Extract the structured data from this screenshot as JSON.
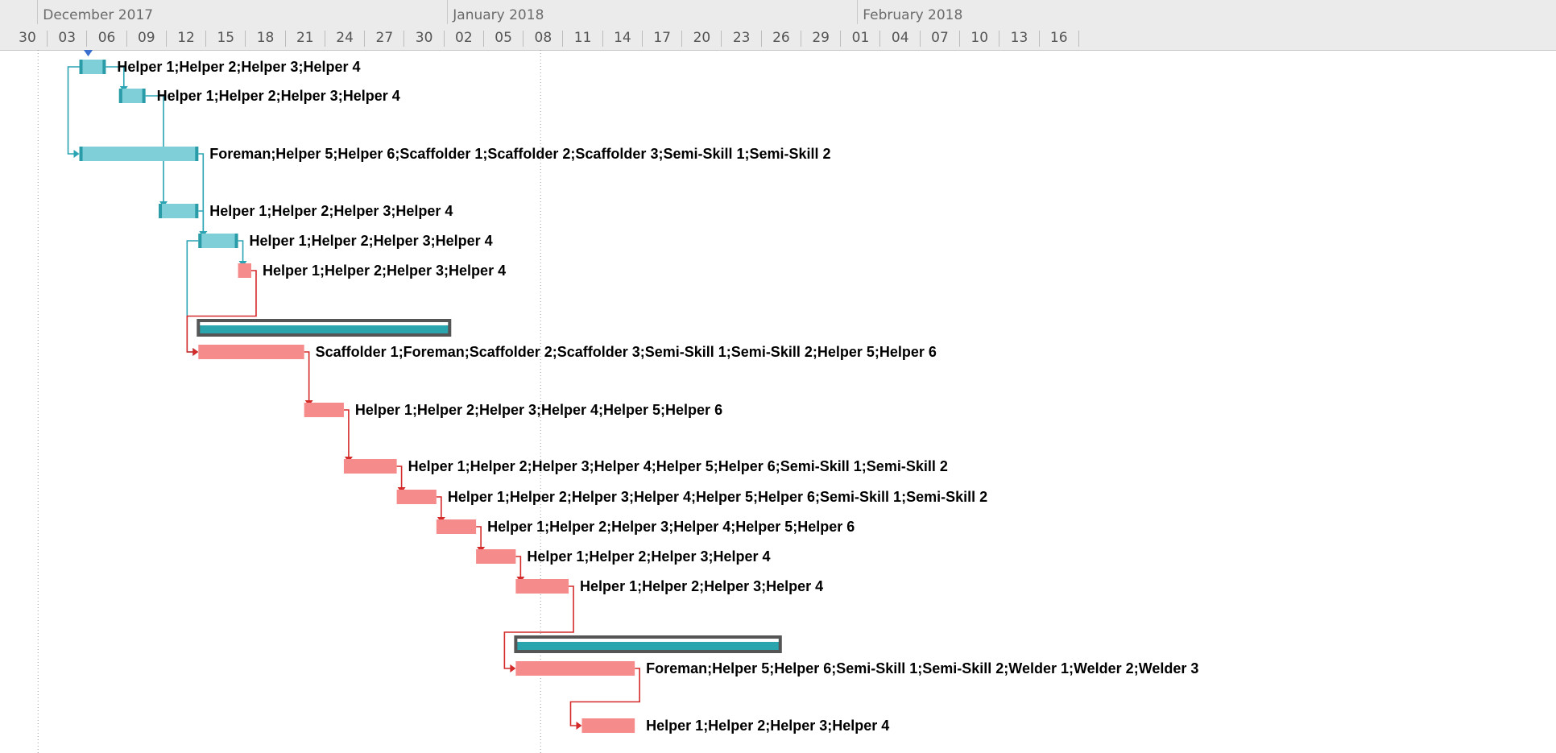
{
  "timescale": {
    "months": [
      "December 2017",
      "January 2018",
      "February 2018"
    ],
    "days": [
      "30",
      "03",
      "06",
      "09",
      "12",
      "15",
      "18",
      "21",
      "24",
      "27",
      "30",
      "02",
      "05",
      "08",
      "11",
      "14",
      "17",
      "20",
      "23",
      "26",
      "29",
      "01",
      "04",
      "07",
      "10",
      "13",
      "16"
    ]
  },
  "colors": {
    "normal_task": "#7ecfd8",
    "normal_link": "#2aa3b3",
    "critical_task": "#f58b8b",
    "critical_link": "#d42a2a",
    "summary_fill": "#2ba5ad",
    "summary_border": "#555555",
    "milestone": "#3a6fcf"
  },
  "chart_data": {
    "type": "gantt",
    "tasks": [
      {
        "start": "2017-12-04",
        "finish": "2017-12-06",
        "kind": "normal",
        "resources": "Helper 1;Helper 2;Helper 3;Helper 4"
      },
      {
        "start": "2017-12-07",
        "finish": "2017-12-09",
        "kind": "normal",
        "resources": "Helper 1;Helper 2;Helper 3;Helper 4"
      },
      {
        "start": "2017-12-04",
        "finish": "2017-12-13",
        "kind": "normal",
        "resources": "Foreman;Helper 5;Helper 6;Scaffolder 1;Scaffolder 2;Scaffolder 3;Semi-Skill 1;Semi-Skill 2"
      },
      {
        "start": "2017-12-10",
        "finish": "2017-12-13",
        "kind": "normal",
        "resources": "Helper 1;Helper 2;Helper 3;Helper 4"
      },
      {
        "start": "2017-12-13",
        "finish": "2017-12-16",
        "kind": "normal",
        "resources": "Helper 1;Helper 2;Helper 3;Helper 4"
      },
      {
        "start": "2017-12-16",
        "finish": "2017-12-17",
        "kind": "critical",
        "resources": "Helper 1;Helper 2;Helper 3;Helper 4"
      },
      {
        "start": "2017-12-13",
        "finish": "2018-01-01",
        "kind": "summary",
        "resources": ""
      },
      {
        "start": "2017-12-13",
        "finish": "2017-12-21",
        "kind": "critical",
        "resources": "Scaffolder 1;Foreman;Scaffolder 2;Scaffolder 3;Semi-Skill 1;Semi-Skill 2;Helper 5;Helper 6"
      },
      {
        "start": "2017-12-21",
        "finish": "2017-12-24",
        "kind": "critical",
        "resources": "Helper 1;Helper 2;Helper 3;Helper 4;Helper 5;Helper 6"
      },
      {
        "start": "2017-12-24",
        "finish": "2017-12-28",
        "kind": "critical",
        "resources": "Helper 1;Helper 2;Helper 3;Helper 4;Helper 5;Helper 6;Semi-Skill 1;Semi-Skill 2"
      },
      {
        "start": "2017-12-28",
        "finish": "2017-12-31",
        "kind": "critical",
        "resources": "Helper 1;Helper 2;Helper 3;Helper 4;Helper 5;Helper 6;Semi-Skill 1;Semi-Skill 2"
      },
      {
        "start": "2017-12-31",
        "finish": "2018-01-03",
        "kind": "critical",
        "resources": "Helper 1;Helper 2;Helper 3;Helper 4;Helper 5;Helper 6"
      },
      {
        "start": "2018-01-03",
        "finish": "2018-01-06",
        "kind": "critical",
        "resources": "Helper 1;Helper 2;Helper 3;Helper 4"
      },
      {
        "start": "2018-01-06",
        "finish": "2018-01-10",
        "kind": "critical",
        "resources": "Helper 1;Helper 2;Helper 3;Helper 4"
      },
      {
        "start": "2018-01-06",
        "finish": "2018-01-26",
        "kind": "summary",
        "resources": ""
      },
      {
        "start": "2018-01-06",
        "finish": "2018-01-15",
        "kind": "critical",
        "resources": "Foreman;Helper 5;Helper 6;Semi-Skill 1;Semi-Skill 2;Welder 1;Welder 2;Welder 3"
      },
      {
        "start": "2018-01-11",
        "finish": "2018-01-15",
        "kind": "critical",
        "resources": "Helper 1;Helper 2;Helper 3;Helper 4"
      }
    ]
  }
}
